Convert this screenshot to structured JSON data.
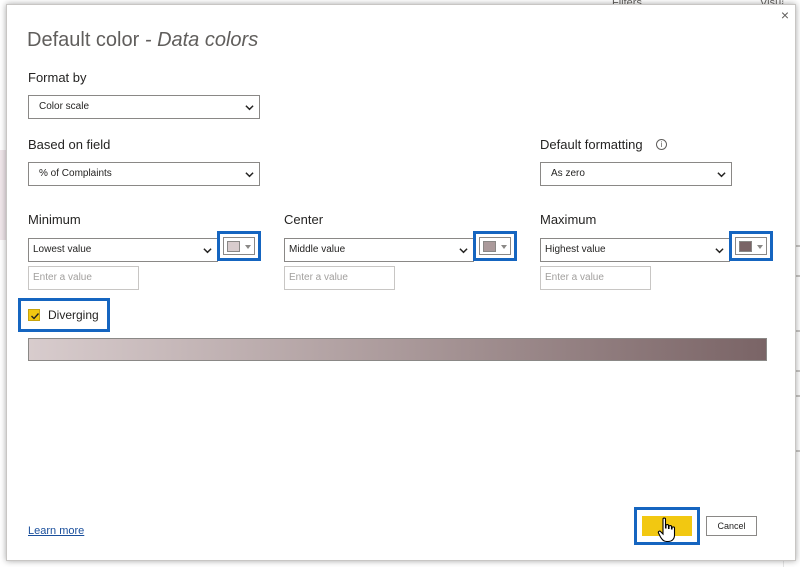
{
  "background": {
    "right_panel_titles": [
      "Filters",
      "Visual"
    ]
  },
  "dialog": {
    "close_symbol": "×",
    "title": {
      "main": "Default color",
      "separator": " - ",
      "sub": "Data colors"
    },
    "format_by": {
      "label": "Format by",
      "value": "Color scale"
    },
    "based_on_field": {
      "label": "Based on field",
      "value": "% of Complaints"
    },
    "default_formatting": {
      "label": "Default formatting",
      "info_icon": "info-icon",
      "value": "As zero"
    },
    "minimum": {
      "label": "Minimum",
      "value": "Lowest value",
      "placeholder": "Enter a value",
      "color": "#d8cccd"
    },
    "center": {
      "label": "Center",
      "value": "Middle value",
      "placeholder": "Enter a value",
      "color": "#ab9a9b"
    },
    "maximum": {
      "label": "Maximum",
      "value": "Highest value",
      "placeholder": "Enter a value",
      "color": "#7a6466"
    },
    "diverging": {
      "label": "Diverging",
      "checked": true
    },
    "learn_more": "Learn more",
    "ok_label": "",
    "cancel_label": "Cancel"
  },
  "colors": {
    "accent_yellow": "#f2c811",
    "highlight_blue": "#1565c0",
    "link_blue": "#1a4f9c"
  }
}
